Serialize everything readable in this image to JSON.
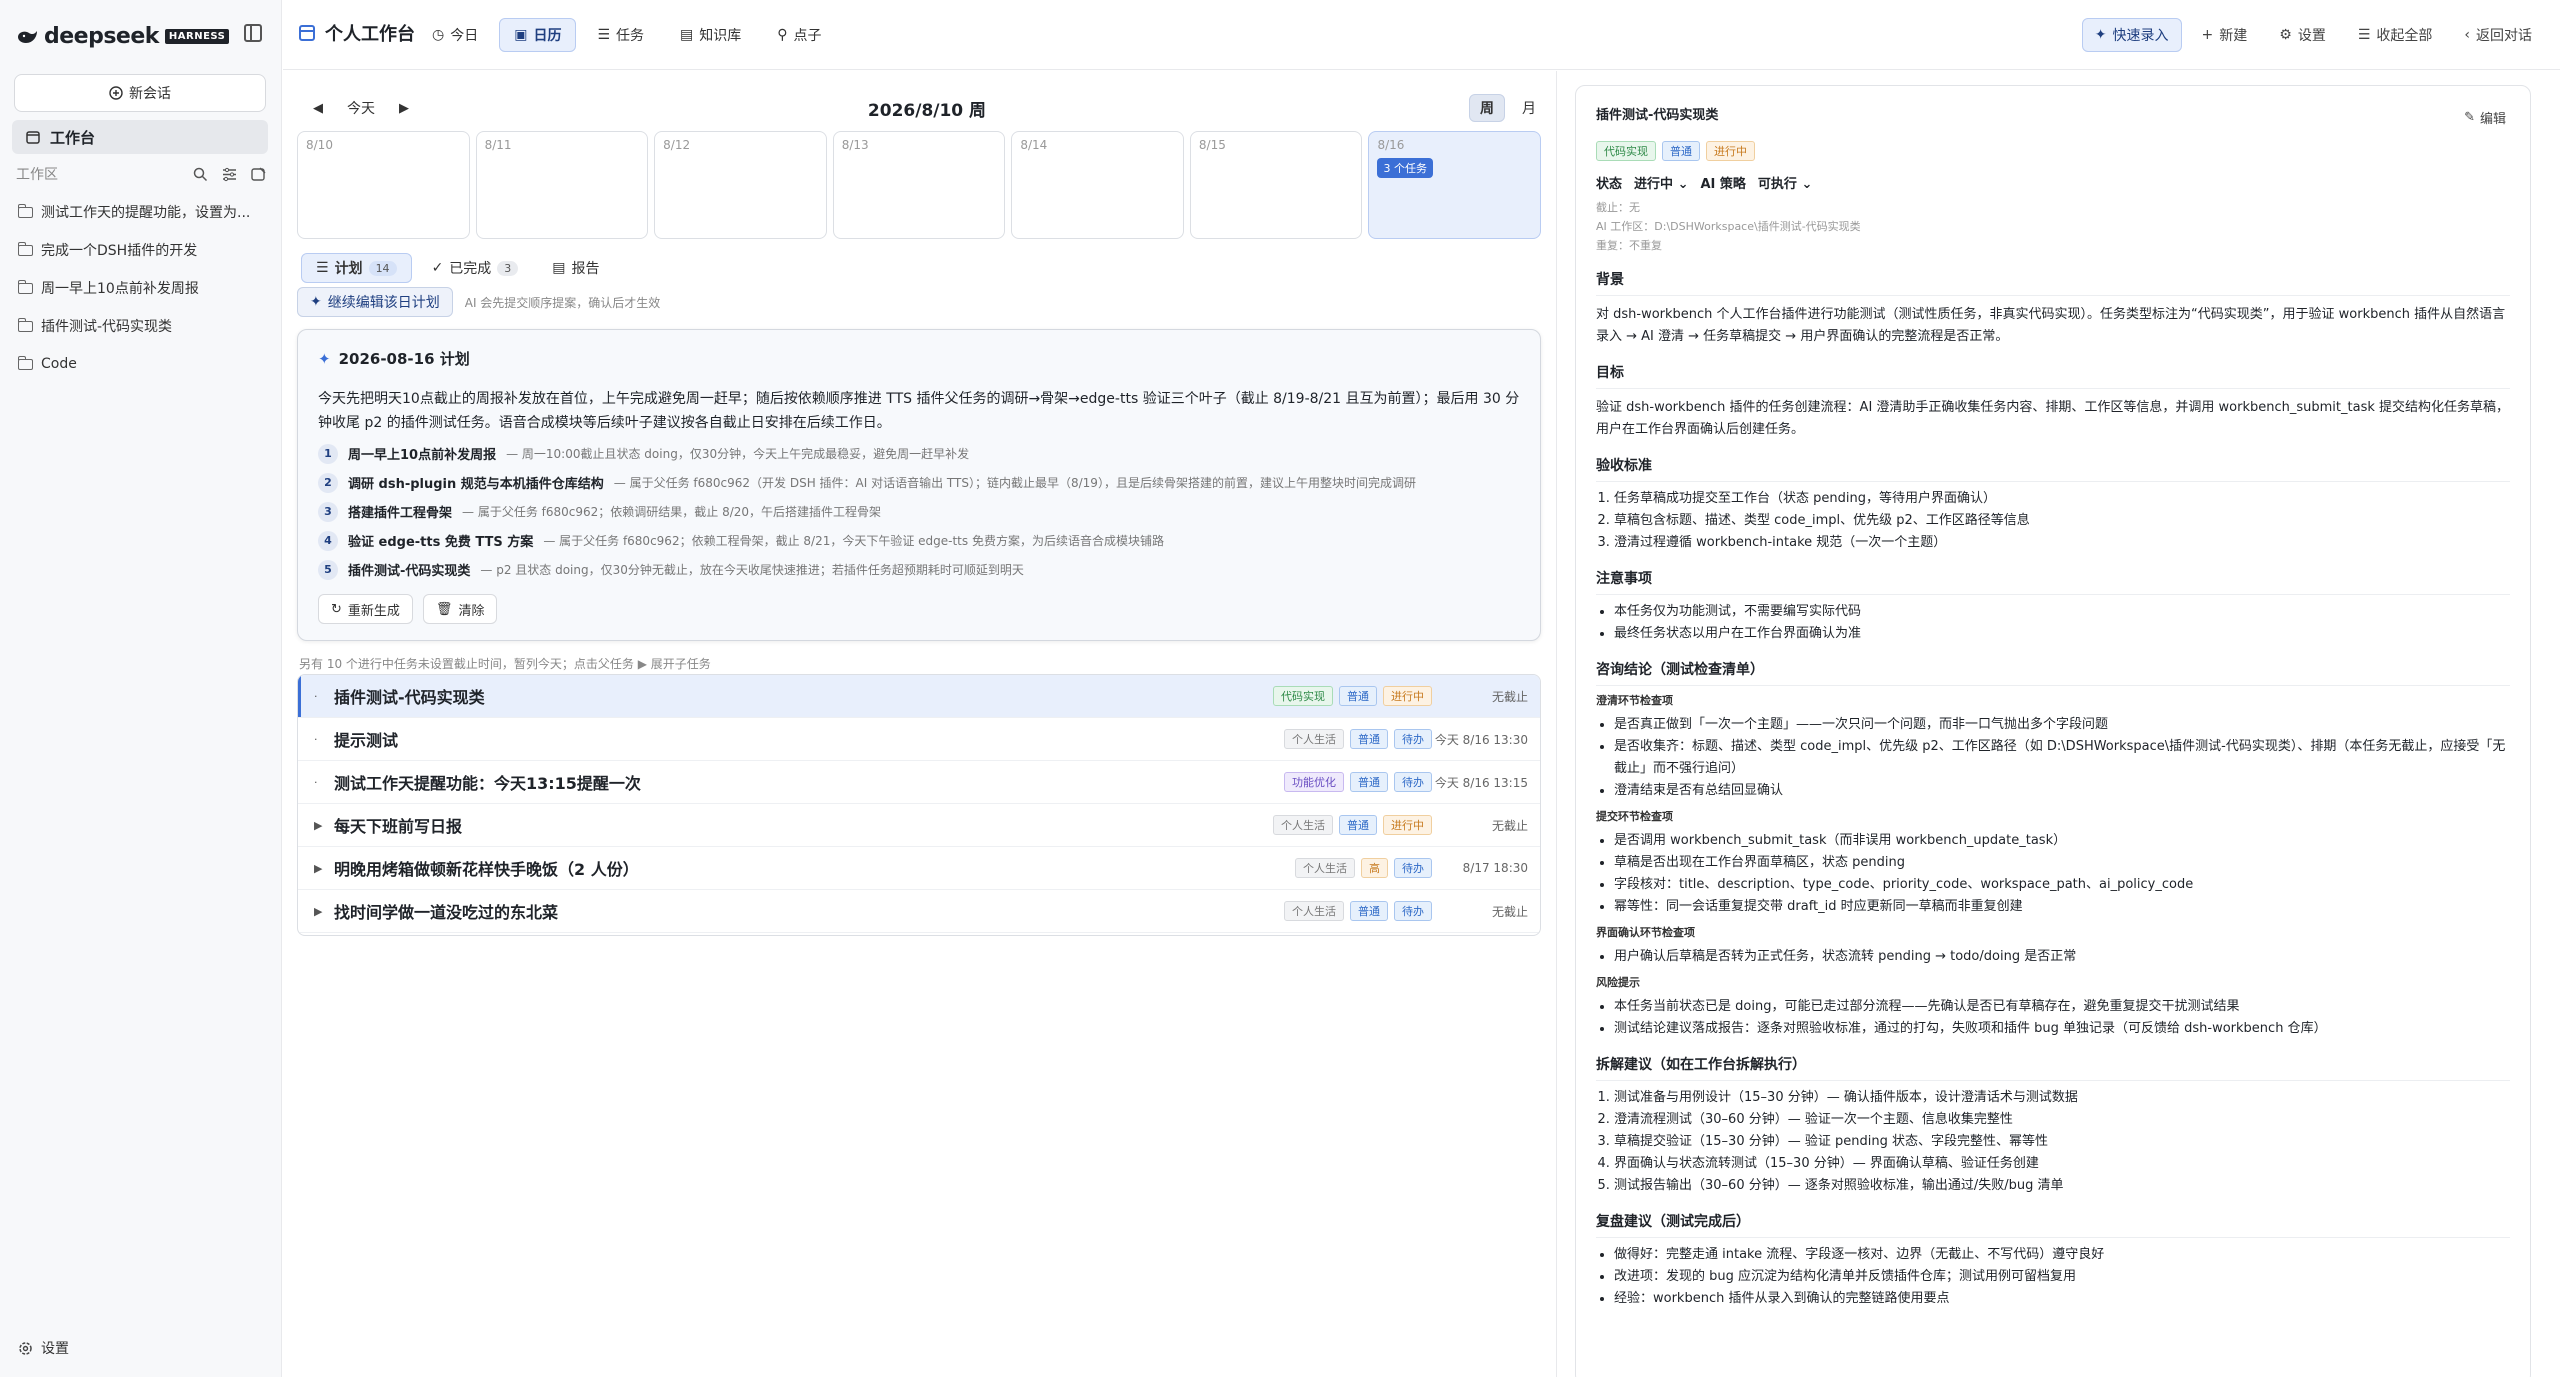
{
  "sidebar": {
    "brand": "deepseek",
    "brand_badge": "HARNESS",
    "new_chat": "新会话",
    "workbench": "工作台",
    "workspace_label": "工作区",
    "items": [
      {
        "label": "测试工作天的提醒功能，设置为..."
      },
      {
        "label": "完成一个DSH插件的开发"
      },
      {
        "label": "周一早上10点前补发周报"
      },
      {
        "label": "插件测试-代码实现类"
      },
      {
        "label": "Code"
      }
    ],
    "settings": "设置"
  },
  "topbar": {
    "title": "个人工作台",
    "tabs": [
      {
        "label": "今日",
        "icon": "clock-icon"
      },
      {
        "label": "日历",
        "icon": "calendar-icon"
      },
      {
        "label": "任务",
        "icon": "list-icon"
      },
      {
        "label": "知识库",
        "icon": "book-icon"
      },
      {
        "label": "点子",
        "icon": "pin-icon"
      }
    ],
    "actions": {
      "quick": "快速录入",
      "new": "新建",
      "settings": "设置",
      "collapse": "收起全部",
      "back": "返回对话"
    }
  },
  "calendar": {
    "prev": "◀",
    "today": "今天",
    "next": "▶",
    "week_title": "2026/8/10 周",
    "view_week": "周",
    "view_month": "月",
    "days": [
      {
        "date": "8/10",
        "count": ""
      },
      {
        "date": "8/11",
        "count": ""
      },
      {
        "date": "8/12",
        "count": ""
      },
      {
        "date": "8/13",
        "count": ""
      },
      {
        "date": "8/14",
        "count": ""
      },
      {
        "date": "8/15",
        "count": ""
      },
      {
        "date": "8/16",
        "count": "3 个任务"
      }
    ]
  },
  "subtabs": {
    "plan": "计划",
    "plan_count": "14",
    "done": "已完成",
    "done_count": "3",
    "report": "报告"
  },
  "continue": {
    "button": "继续编辑该日计划",
    "hint": "AI 会先提交顺序提案，确认后才生效"
  },
  "plan": {
    "title": "2026-08-16 计划",
    "summary": "今天先把明天10点截止的周报补发放在首位，上午完成避免周一赶早；随后按依赖顺序推进 TTS 插件父任务的调研→骨架→edge-tts 验证三个叶子（截止 8/19-8/21 且互为前置）；最后用 30 分钟收尾 p2 的插件测试任务。语音合成模块等后续叶子建议按各自截止日安排在后续工作日。",
    "steps": [
      {
        "num": "1",
        "title": "周一早上10点前补发周报",
        "desc": "— 周一10:00截止且状态 doing，仅30分钟，今天上午完成最稳妥，避免周一赶早补发"
      },
      {
        "num": "2",
        "title": "调研 dsh-plugin 规范与本机插件仓库结构",
        "desc": "— 属于父任务 f680c962（开发 DSH 插件：AI 对话语音输出 TTS）；链内截止最早（8/19），且是后续骨架搭建的前置，建议上午用整块时间完成调研"
      },
      {
        "num": "3",
        "title": "搭建插件工程骨架",
        "desc": "— 属于父任务 f680c962；依赖调研结果，截止 8/20，午后搭建插件工程骨架"
      },
      {
        "num": "4",
        "title": "验证 edge-tts 免费 TTS 方案",
        "desc": "— 属于父任务 f680c962；依赖工程骨架，截止 8/21，今天下午验证 edge-tts 免费方案，为后续语音合成模块铺路"
      },
      {
        "num": "5",
        "title": "插件测试-代码实现类",
        "desc": "— p2 且状态 doing，仅30分钟无截止，放在今天收尾快速推进；若插件任务超预期耗时可顺延到明天"
      }
    ],
    "regen": "重新生成",
    "clear": "清除"
  },
  "note": "另有 10 个进行中任务未设置截止时间，暂列今天；点击父任务 ▶ 展开子任务",
  "tasks": [
    {
      "name": "插件测试-代码实现类",
      "caret": "·",
      "tags": [
        {
          "t": "代码实现",
          "c": "green"
        },
        {
          "t": "普通",
          "c": "blue"
        },
        {
          "t": "进行中",
          "c": "orange"
        }
      ],
      "due": "无截止"
    },
    {
      "name": "提示测试",
      "caret": "·",
      "tags": [
        {
          "t": "个人生活",
          "c": "gray"
        },
        {
          "t": "普通",
          "c": "blue"
        },
        {
          "t": "待办",
          "c": "blue"
        }
      ],
      "due": "今天 8/16 13:30"
    },
    {
      "name": "测试工作天提醒功能：今天13:15提醒一次",
      "caret": "·",
      "tags": [
        {
          "t": "功能优化",
          "c": "purple"
        },
        {
          "t": "普通",
          "c": "blue"
        },
        {
          "t": "待办",
          "c": "blue"
        }
      ],
      "due": "今天 8/16 13:15"
    },
    {
      "name": "每天下班前写日报",
      "caret": "▶",
      "tags": [
        {
          "t": "个人生活",
          "c": "gray"
        },
        {
          "t": "普通",
          "c": "blue"
        },
        {
          "t": "进行中",
          "c": "orange"
        }
      ],
      "due": "无截止"
    },
    {
      "name": "明晚用烤箱做顿新花样快手晚饭（2 人份）",
      "caret": "▶",
      "tags": [
        {
          "t": "个人生活",
          "c": "gray"
        },
        {
          "t": "高",
          "c": "orange"
        },
        {
          "t": "待办",
          "c": "blue"
        }
      ],
      "due": "8/17 18:30"
    },
    {
      "name": "找时间学做一道没吃过的东北菜",
      "caret": "▶",
      "tags": [
        {
          "t": "个人生活",
          "c": "gray"
        },
        {
          "t": "普通",
          "c": "blue"
        },
        {
          "t": "待办",
          "c": "blue"
        }
      ],
      "due": "无截止"
    }
  ],
  "detail": {
    "title": "插件测试-代码实现类",
    "edit": "编辑",
    "tags": [
      {
        "t": "代码实现",
        "c": "green"
      },
      {
        "t": "普通",
        "c": "blue"
      },
      {
        "t": "进行中",
        "c": "orange"
      }
    ],
    "status_label": "状态",
    "status_value": "进行中",
    "ai_label": "AI 策略",
    "ai_value": "可执行",
    "meta": [
      "截止：无",
      "AI 工作区：D:\\DSHWorkspace\\插件测试-代码实现类",
      "重复：不重复"
    ],
    "bg_h": "背景",
    "bg_p": "对 dsh-workbench 个人工作台插件进行功能测试（测试性质任务，非真实代码实现）。任务类型标注为“代码实现类”，用于验证 workbench 插件从自然语言录入 → AI 澄清 → 任务草稿提交 → 用户界面确认的完整流程是否正常。",
    "goal_h": "目标",
    "goal_p": "验证 dsh-workbench 插件的任务创建流程：AI 澄清助手正确收集任务内容、排期、工作区等信息，并调用 workbench_submit_task 提交结构化任务草稿，用户在工作台界面确认后创建任务。",
    "acc_h": "验收标准",
    "acc": [
      "任务草稿成功提交至工作台（状态 pending，等待用户界面确认）",
      "草稿包含标题、描述、类型 code_impl、优先级 p2、工作区路径等信息",
      "澄清过程遵循 workbench-intake 规范（一次一个主题）"
    ],
    "att_h": "注意事项",
    "att": [
      "本任务仅为功能测试，不需要编写实际代码",
      "最终任务状态以用户在工作台界面确认为准"
    ],
    "con_h": "咨询结论（测试检查清单）",
    "c1_h": "澄清环节检查项",
    "c1": [
      "是否真正做到「一次一个主题」——一次只问一个问题，而非一口气抛出多个字段问题",
      "是否收集齐：标题、描述、类型 code_impl、优先级 p2、工作区路径（如 D:\\DSHWorkspace\\插件测试-代码实现类）、排期（本任务无截止，应接受「无截止」而不强行追问）",
      "澄清结束是否有总结回显确认"
    ],
    "c2_h": "提交环节检查项",
    "c2": [
      "是否调用 workbench_submit_task（而非误用 workbench_update_task）",
      "草稿是否出现在工作台界面草稿区，状态 pending",
      "字段核对：title、description、type_code、priority_code、workspace_path、ai_policy_code",
      "幂等性：同一会话重复提交带 draft_id 时应更新同一草稿而非重复创建"
    ],
    "c3_h": "界面确认环节检查项",
    "c3": [
      "用户确认后草稿是否转为正式任务，状态流转 pending → todo/doing 是否正常"
    ],
    "c4_h": "风险提示",
    "c4": [
      "本任务当前状态已是 doing，可能已走过部分流程——先确认是否已有草稿存在，避免重复提交干扰测试结果",
      "测试结论建议落成报告：逐条对照验收标准，通过的打勾，失败项和插件 bug 单独记录（可反馈给 dsh-workbench 仓库）"
    ],
    "split_h": "拆解建议（如在工作台拆解执行）",
    "split": [
      "测试准备与用例设计（15–30 分钟）— 确认插件版本，设计澄清话术与测试数据",
      "澄清流程测试（30–60 分钟）— 验证一次一个主题、信息收集完整性",
      "草稿提交验证（15–30 分钟）— 验证 pending 状态、字段完整性、幂等性",
      "界面确认与状态流转测试（15–30 分钟）— 界面确认草稿、验证任务创建",
      "测试报告输出（30–60 分钟）— 逐条对照验收标准，输出通过/失败/bug 清单"
    ],
    "rev_h": "复盘建议（测试完成后）",
    "rev": [
      "做得好：完整走通 intake 流程、字段逐一核对、边界（无截止、不写代码）遵守良好",
      "改进项：发现的 bug 应沉淀为结构化清单并反馈插件仓库；测试用例可留档复用",
      "经验：workbench 插件从录入到确认的完整链路使用要点"
    ]
  }
}
